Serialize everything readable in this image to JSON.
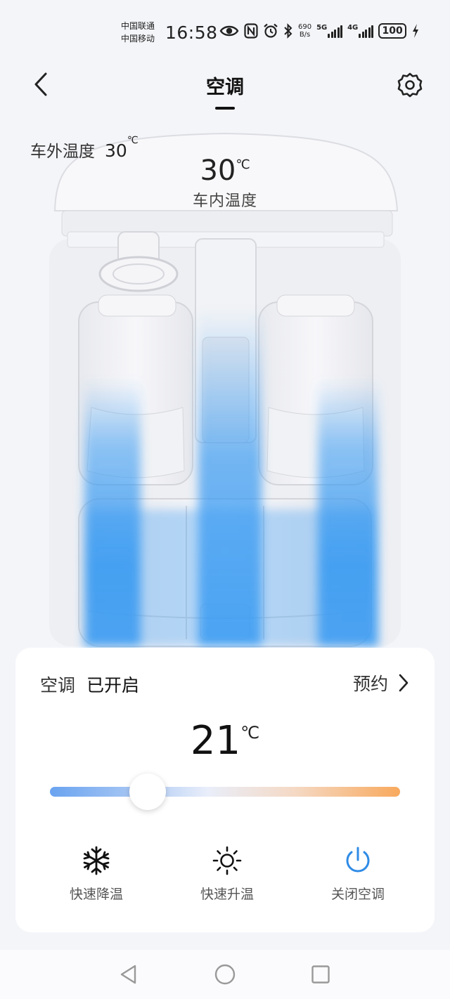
{
  "status_bar": {
    "carrier_1": "中国联通",
    "carrier_2": "中国移动",
    "time": "16:58",
    "net_speed_value": "690",
    "net_speed_unit": "B/s",
    "signal_1_tag": "5G",
    "signal_2_tag": "4G",
    "battery": "100",
    "icons": [
      "eye-icon",
      "nfc-icon",
      "alarm-icon",
      "bluetooth-icon",
      "signal-icon",
      "signal-icon",
      "battery-icon",
      "charging-icon"
    ]
  },
  "header": {
    "title": "空调",
    "back_icon": "chevron-left-icon",
    "settings_icon": "gear-icon"
  },
  "car": {
    "outside_label": "车外温度",
    "outside_temp": "30",
    "outside_unit": "℃",
    "inside_temp": "30",
    "inside_unit": "℃",
    "inside_label": "车内温度"
  },
  "control": {
    "ac_label": "空调",
    "ac_state": "已开启",
    "schedule_label": "预约",
    "set_temp": "21",
    "set_temp_unit": "℃",
    "slider_fraction": 0.28,
    "actions": [
      {
        "label": "快速降温",
        "icon": "snowflake-icon"
      },
      {
        "label": "快速升温",
        "icon": "sun-icon"
      },
      {
        "label": "关闭空调",
        "icon": "power-icon"
      }
    ],
    "accent_color": "#2f8be6",
    "airflow_color": "#3a9bf2"
  },
  "nav": {
    "icons": [
      "back-triangle-icon",
      "home-circle-icon",
      "recents-square-icon"
    ]
  }
}
